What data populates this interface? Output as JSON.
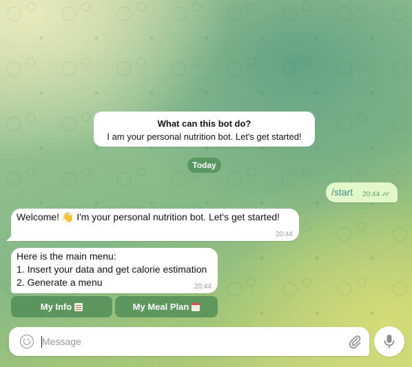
{
  "bot_info": {
    "title": "What can this bot do?",
    "description": "I am your personal nutrition bot. Let's get started!"
  },
  "date_separator": "Today",
  "messages": {
    "outgoing": {
      "text": "/start",
      "time": "20:44",
      "status": "read"
    },
    "welcome": {
      "text": "Welcome! 👋 I'm your personal nutrition bot. Let's get started!",
      "time": "20:44"
    },
    "menu": {
      "lines": [
        "Here is the main menu:",
        "1. Insert your data and get calorie estimation",
        "2. Generate a menu"
      ],
      "time": "20:44"
    }
  },
  "keyboard": {
    "buttons": [
      {
        "label": "My Info",
        "icon": "memo-icon"
      },
      {
        "label": "My Meal Plan",
        "icon": "calendar-icon"
      }
    ]
  },
  "composer": {
    "placeholder": "Message",
    "value": ""
  },
  "colors": {
    "outgoing_bubble": "#e3f8c9",
    "incoming_bubble": "#ffffff",
    "accent_green": "#5aa361"
  }
}
